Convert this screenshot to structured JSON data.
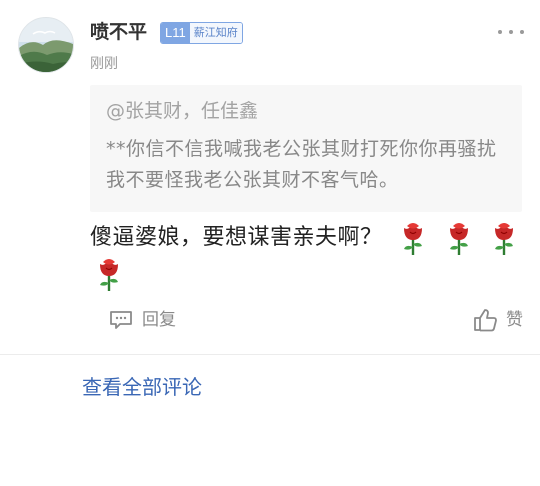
{
  "comment": {
    "author": "喷不平",
    "level_badge": "L11",
    "badge_org": "薪江知府",
    "time": "刚刚",
    "quote": {
      "author": "@张其财，任佳鑫",
      "text": "**你信不信我喊我老公张其财打死你你再骚扰我不要怪我老公张其财不客气哈。"
    },
    "content": "傻逼婆娘，要想谋害亲夫啊？",
    "emoji": [
      "rose-icon",
      "rose-icon",
      "rose-icon",
      "rose-icon"
    ],
    "actions": {
      "reply_label": "回复",
      "like_label": "赞"
    }
  },
  "footer": {
    "view_all_label": "查看全部评论"
  },
  "colors": {
    "link": "#3a67b5",
    "badge": "#7fa6e3",
    "quote_bg": "#f7f7f7"
  }
}
